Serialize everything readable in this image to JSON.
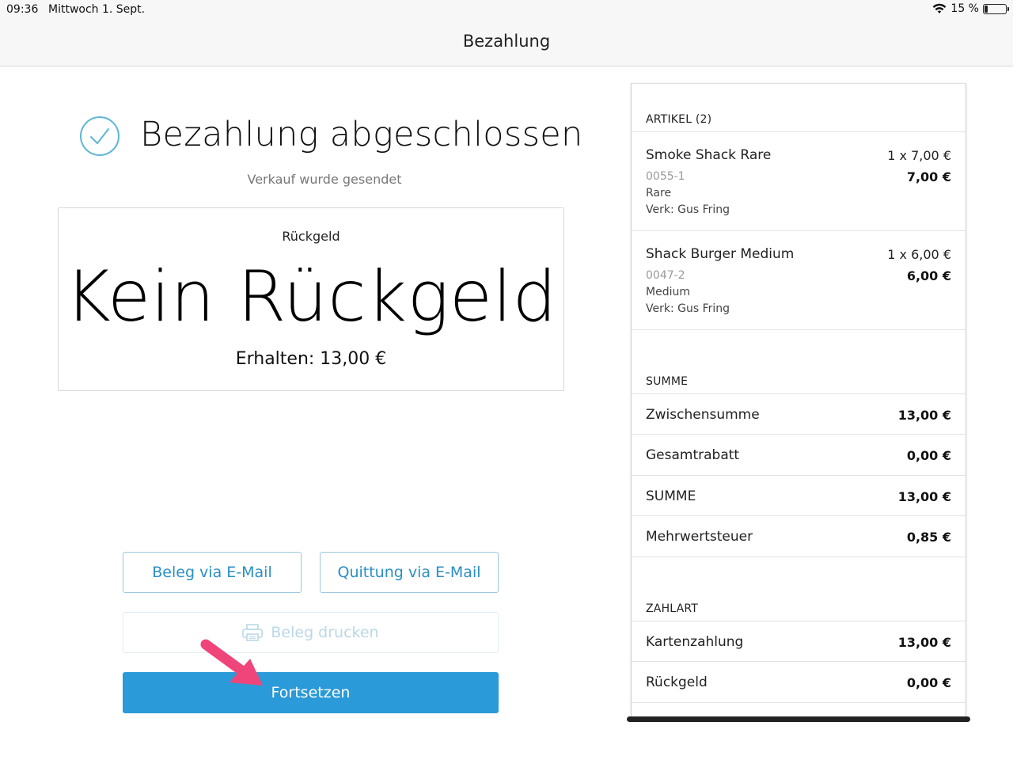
{
  "status_bar": {
    "time": "09:36",
    "date": "Mittwoch 1. Sept.",
    "battery": "15 %",
    "battery_level": 0.15
  },
  "nav": {
    "title": "Bezahlung"
  },
  "success": {
    "title": "Bezahlung abgeschlossen",
    "subtitle": "Verkauf wurde gesendet"
  },
  "change": {
    "label": "Rückgeld",
    "value": "Kein Rückgeld",
    "received": "Erhalten: 13,00 €"
  },
  "buttons": {
    "email_receipt": "Beleg via E-Mail",
    "email_invoice": "Quittung via E-Mail",
    "print": "Beleg drucken",
    "continue": "Fortsetzen"
  },
  "receipt": {
    "items_title": "ARTIKEL (2)",
    "items": [
      {
        "name": "Smoke Shack Rare",
        "qty_price": "1 x 7,00 €",
        "total": "7,00 €",
        "sku": "0055-1",
        "variant": "Rare",
        "seller": "Verk: Gus Fring"
      },
      {
        "name": "Shack Burger Medium",
        "qty_price": "1 x 6,00 €",
        "total": "6,00 €",
        "sku": "0047-2",
        "variant": "Medium",
        "seller": "Verk: Gus Fring"
      }
    ],
    "sum_title": "SUMME",
    "sum_rows": [
      {
        "label": "Zwischensumme",
        "value": "13,00 €"
      },
      {
        "label": "Gesamtrabatt",
        "value": "0,00 €"
      },
      {
        "label": "SUMME",
        "value": "13,00 €"
      },
      {
        "label": "Mehrwertsteuer",
        "value": "0,85 €"
      }
    ],
    "payment_title": "ZAHLART",
    "payment_rows": [
      {
        "label": "Kartenzahlung",
        "value": "13,00 €"
      },
      {
        "label": "Rückgeld",
        "value": "0,00 €"
      }
    ]
  },
  "colors": {
    "accent": "#2a9ad8",
    "success_icon": "#5bb6d4",
    "annotation_arrow": "#f0457a"
  },
  "icons": [
    "wifi-icon",
    "battery-icon",
    "checkmark-circle-icon",
    "printer-icon",
    "arrow-annotation-icon"
  ]
}
